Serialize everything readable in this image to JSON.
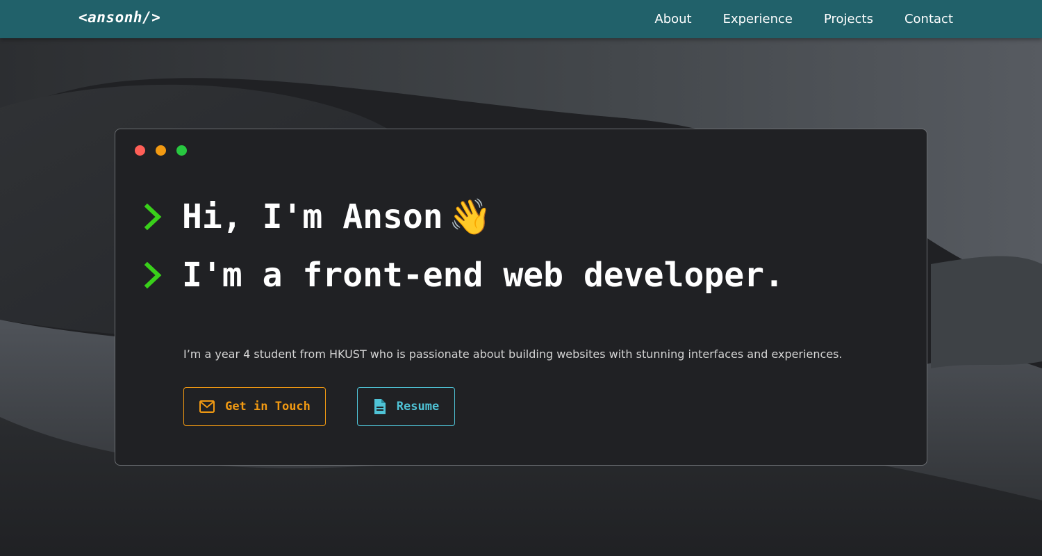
{
  "header": {
    "logo": "<ansonh/>",
    "nav": [
      {
        "label": "About"
      },
      {
        "label": "Experience"
      },
      {
        "label": "Projects"
      },
      {
        "label": "Contact"
      }
    ]
  },
  "hero": {
    "window_controls": [
      "red-dot",
      "yellow-dot",
      "green-dot"
    ],
    "greeting": "Hi, I'm Anson",
    "greeting_emoji": "👋",
    "tagline": "I'm a front-end web developer.",
    "bio": "I’m a year 4 student from HKUST who is passionate about building websites with stunning interfaces and experiences.",
    "buttons": {
      "contact_label": "Get in Touch",
      "resume_label": "Resume"
    }
  },
  "icons": {
    "prompt": "chevron-right-icon",
    "contact": "mail-icon",
    "resume": "document-icon"
  },
  "colors": {
    "navbar": "#21616a",
    "background": "#202124",
    "prompt_accent": "#39d01a",
    "contact_accent": "#f29a12",
    "resume_accent": "#4fc3d6"
  }
}
